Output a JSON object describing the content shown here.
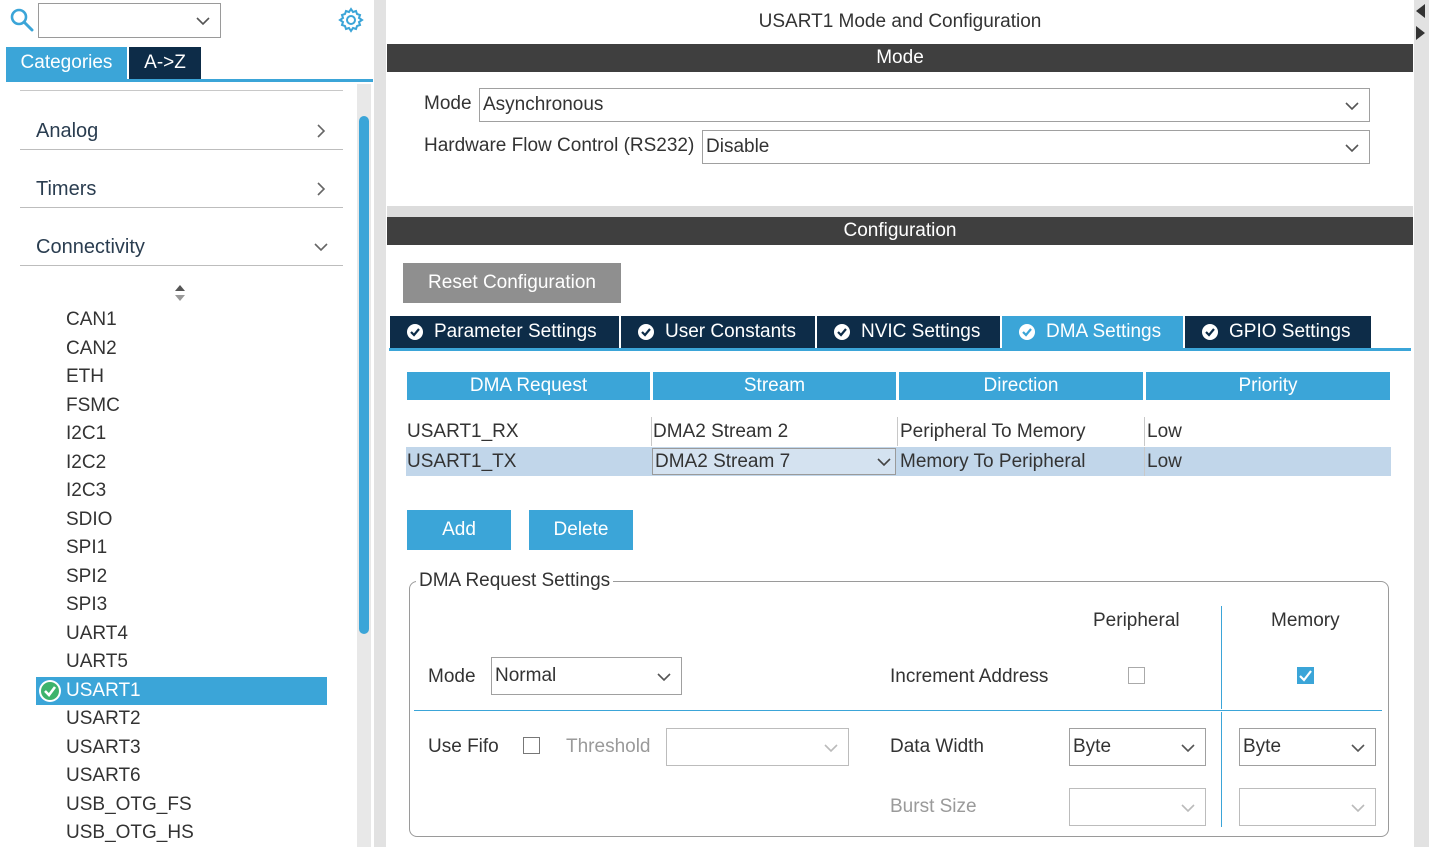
{
  "sidebar": {
    "search": {
      "value": ""
    },
    "tabs": [
      {
        "label": "Categories"
      },
      {
        "label": "A->Z"
      }
    ],
    "categories": [
      {
        "label": "Analog",
        "state": "collapsed"
      },
      {
        "label": "Timers",
        "state": "collapsed"
      },
      {
        "label": "Connectivity",
        "state": "expanded"
      }
    ],
    "peripherals": [
      "CAN1",
      "CAN2",
      "ETH",
      "FSMC",
      "I2C1",
      "I2C2",
      "I2C3",
      "SDIO",
      "SPI1",
      "SPI2",
      "SPI3",
      "UART4",
      "UART5",
      "USART1",
      "USART2",
      "USART3",
      "USART6",
      "USB_OTG_FS",
      "USB_OTG_HS"
    ],
    "selected": "USART1"
  },
  "main": {
    "title": "USART1 Mode and Configuration",
    "mode_header": "Mode",
    "mode": {
      "label": "Mode",
      "value": "Asynchronous"
    },
    "flow": {
      "label": "Hardware Flow Control (RS232)",
      "value": "Disable"
    },
    "config_header": "Configuration",
    "reset_label": "Reset Configuration",
    "tabs": [
      {
        "label": "Parameter Settings"
      },
      {
        "label": "User Constants"
      },
      {
        "label": "NVIC Settings"
      },
      {
        "label": "DMA Settings",
        "active": true
      },
      {
        "label": "GPIO Settings"
      }
    ],
    "dma_table": {
      "headers": [
        "DMA Request",
        "Stream",
        "Direction",
        "Priority"
      ],
      "rows": [
        [
          "USART1_RX",
          "DMA2 Stream 2",
          "Peripheral To Memory",
          "Low"
        ],
        [
          "USART1_TX",
          "DMA2 Stream 7",
          "Memory To Peripheral",
          "Low"
        ]
      ],
      "selected_row": 1
    },
    "add_label": "Add",
    "delete_label": "Delete",
    "request_settings": {
      "legend": "DMA Request Settings",
      "peripheral_header": "Peripheral",
      "memory_header": "Memory",
      "mode_label": "Mode",
      "mode_value": "Normal",
      "increment_label": "Increment Address",
      "increment_peripheral": false,
      "increment_memory": true,
      "fifo_label": "Use Fifo",
      "fifo_checked": false,
      "threshold_label": "Threshold",
      "threshold_value": "",
      "data_width_label": "Data Width",
      "data_width_peripheral": "Byte",
      "data_width_memory": "Byte",
      "burst_label": "Burst Size",
      "burst_peripheral": "",
      "burst_memory": ""
    }
  },
  "colors": {
    "accent": "#3ba5d8",
    "dark_navy": "#0d2c48",
    "header_grey": "#3f3f3f",
    "selected_row": "#c1d6ea"
  }
}
